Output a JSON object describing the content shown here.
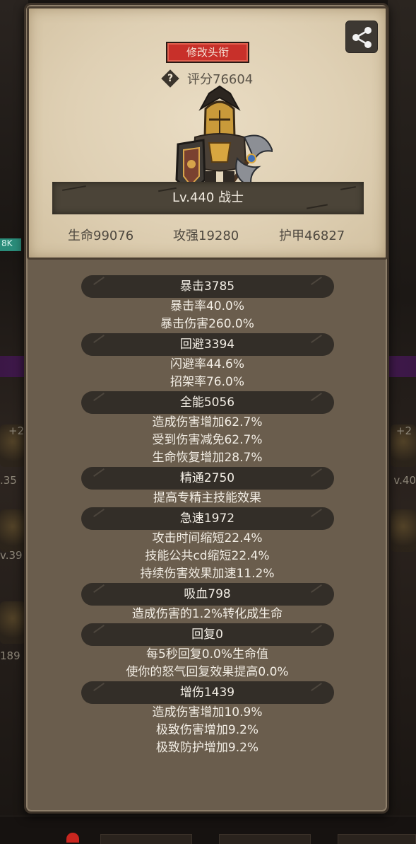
{
  "background": {
    "badge_text": "8K",
    "left_labels": [
      ".35",
      "v.39",
      "189"
    ],
    "right_labels": [
      "v.40"
    ],
    "plus_labels": [
      "+2",
      "+2"
    ]
  },
  "card": {
    "title_button": "修改头衔",
    "score_label": "评分76604",
    "level_text": "Lv.440 战士",
    "stats": {
      "hp": "生命99076",
      "attack": "攻强19280",
      "armor": "护甲46827"
    }
  },
  "attributes": [
    {
      "header": "暴击3785",
      "lines": [
        "暴击率40.0%",
        "暴击伤害260.0%"
      ]
    },
    {
      "header": "回避3394",
      "lines": [
        "闪避率44.6%",
        "招架率76.0%"
      ]
    },
    {
      "header": "全能5056",
      "lines": [
        "造成伤害增加62.7%",
        "受到伤害减免62.7%",
        "生命恢复增加28.7%"
      ]
    },
    {
      "header": "精通2750",
      "lines": [
        "提高专精主技能效果"
      ]
    },
    {
      "header": "急速1972",
      "lines": [
        "攻击时间缩短22.4%",
        "技能公共cd缩短22.4%",
        "持续伤害效果加速11.2%"
      ]
    },
    {
      "header": "吸血798",
      "lines": [
        "造成伤害的1.2%转化成生命"
      ]
    },
    {
      "header": "回复0",
      "lines": [
        "每5秒回复0.0%生命值",
        "使你的怒气回复效果提高0.0%"
      ]
    },
    {
      "header": "增伤1439",
      "lines": [
        "造成伤害增加10.9%",
        "极致伤害增加9.2%",
        "极致防护增加9.2%"
      ]
    }
  ],
  "colors": {
    "title_button": "#c8302a",
    "parchment": "#e4d6bb",
    "header_bar": "#332e28",
    "panel": "#6a5d4d"
  },
  "icons": {
    "share": "share-icon",
    "help": "question-icon",
    "hero": "warrior-avatar"
  }
}
